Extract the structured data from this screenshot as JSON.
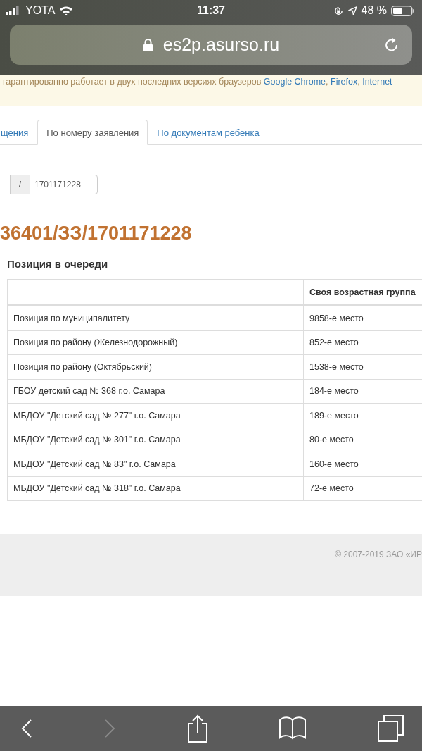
{
  "status_bar": {
    "carrier": "YOTA",
    "time": "11:37",
    "battery": "48 %"
  },
  "address_bar": {
    "url": "es2p.asurso.ru"
  },
  "notice": {
    "parts": [
      {
        "kind": "text",
        "text": "гарантированно работает в двух последних версиях браузеров "
      },
      {
        "kind": "link",
        "text": "Google Chrome"
      },
      {
        "kind": "text",
        "text": ", "
      },
      {
        "kind": "link",
        "text": "Firefox"
      },
      {
        "kind": "text",
        "text": ", "
      },
      {
        "kind": "link",
        "text": "Internet"
      }
    ]
  },
  "tabs": [
    {
      "label": "щения",
      "selected": false
    },
    {
      "label": "По номеру заявления",
      "selected": true
    },
    {
      "label": "По документам ребенка",
      "selected": false
    }
  ],
  "application_number": {
    "separator": "/",
    "value": "1701171228"
  },
  "title": "36401/ЗЗ/1701171228",
  "section_title": "Позиция в очереди",
  "table": {
    "column_2": "Своя возрастная группа",
    "rows": [
      {
        "label": "Позиция по муниципалитету",
        "value": "9858-е место"
      },
      {
        "label": "Позиция по району (Железнодорожный)",
        "value": "852-е место"
      },
      {
        "label": "Позиция по району (Октябрьский)",
        "value": "1538-е место"
      },
      {
        "label": "ГБОУ детский сад № 368 г.о. Самара",
        "value": "184-е место"
      },
      {
        "label": "МБДОУ \"Детский сад № 277\" г.о. Самара",
        "value": "189-е место"
      },
      {
        "label": "МБДОУ \"Детский сад № 301\" г.о. Самара",
        "value": "80-е место"
      },
      {
        "label": "МБДОУ \"Детский сад № 83\" г.о. Самара",
        "value": "160-е место"
      },
      {
        "label": "МБДОУ \"Детский сад № 318\" г.о. Самара",
        "value": "72-е место"
      }
    ]
  },
  "footer": {
    "copyright": "© 2007-2019 ЗАО «ИР"
  },
  "toolbar": {
    "back_disabled": false,
    "forward_disabled": true
  }
}
